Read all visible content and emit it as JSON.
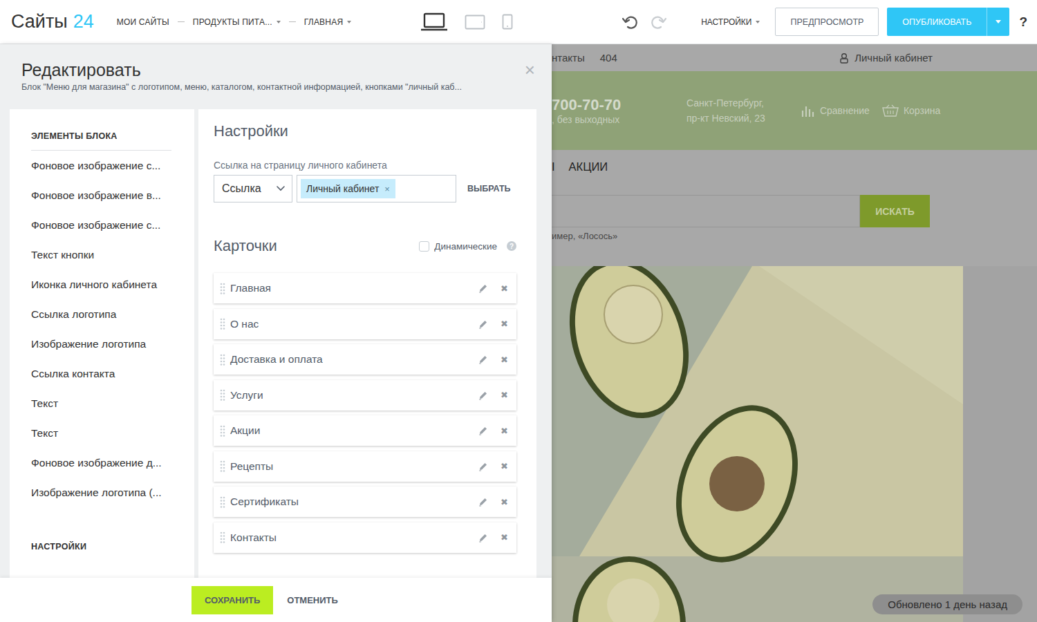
{
  "topbar": {
    "logo": {
      "word": "Сайты",
      "number": "24"
    },
    "breadcrumbs": [
      {
        "label": "МОИ САЙТЫ",
        "dropdown": false
      },
      {
        "label": "ПРОДУКТЫ ПИТА...",
        "dropdown": true
      },
      {
        "label": "ГЛАВНАЯ",
        "dropdown": true
      }
    ],
    "devices": [
      {
        "kind": "laptop",
        "selected": true
      },
      {
        "kind": "tablet",
        "selected": false
      },
      {
        "kind": "phone",
        "selected": false
      }
    ],
    "undo": {
      "disabled": false
    },
    "redo": {
      "disabled": true
    },
    "settings": {
      "label": "НАСТРОЙКИ",
      "dropdown": true
    },
    "preview_button": "ПРЕДПРОСМОТР",
    "publish_button": "ОПУБЛИКОВАТЬ",
    "help": "?"
  },
  "editor": {
    "title": "Редактировать",
    "subtitle": "Блок \"Меню для магазина\" с логотипом, меню, каталогом, контактной информацией, кнопками \"личный каб...",
    "close": "×",
    "elements_heading": "ЭЛЕМЕНТЫ БЛОКА",
    "elements": [
      {
        "label": "Фоновое изображение с...",
        "selected": false
      },
      {
        "label": "Фоновое изображение в...",
        "selected": false
      },
      {
        "label": "Фоновое изображение с...",
        "selected": false
      },
      {
        "label": "Текст кнопки",
        "selected": false
      },
      {
        "label": "Иконка личного кабинета",
        "selected": false
      },
      {
        "label": "Ссылка логотипа",
        "selected": false
      },
      {
        "label": "Изображение логотипа",
        "selected": false
      },
      {
        "label": "Ссылка контакта",
        "selected": false
      },
      {
        "label": "Текст",
        "selected": false
      },
      {
        "label": "Текст",
        "selected": false
      },
      {
        "label": "Фоновое изображение д...",
        "selected": false
      },
      {
        "label": "Изображение логотипа (...",
        "selected": false
      }
    ],
    "settings_heading": "НАСТРОЙКИ",
    "settings": {
      "title": "Настройки",
      "link_label": "Ссылка на страницу личного кабинета",
      "link_type": "Ссылка",
      "link_tag": {
        "label": "Личный кабинет",
        "remove": "×"
      },
      "choose_button": "ВЫБРАТЬ"
    },
    "cards": {
      "title": "Карточки",
      "dynamic": {
        "label": "Динамические",
        "checked": false
      },
      "help": "?",
      "items": [
        {
          "label": "Главная",
          "remove": "✖"
        },
        {
          "label": "О нас",
          "remove": "✖"
        },
        {
          "label": "Доставка и оплата",
          "remove": "✖"
        },
        {
          "label": "Услуги",
          "remove": "✖"
        },
        {
          "label": "Акции",
          "remove": "✖"
        },
        {
          "label": "Рецепты",
          "remove": "✖"
        },
        {
          "label": "Сертификаты",
          "remove": "✖"
        },
        {
          "label": "Контакты",
          "remove": "✖"
        }
      ]
    },
    "save_button": "СОХРАНИТЬ",
    "cancel_button": "ОТМЕНИТЬ"
  },
  "preview": {
    "top_links": [
      "нтакты",
      "404"
    ],
    "account": "Личный кабинет",
    "phone": "700-70-70",
    "hours": ", без выходных",
    "address": [
      "Санкт-Петербург,",
      "пр-кт Невский, 23"
    ],
    "compare": "Сравнение",
    "cart": "Корзина",
    "menu": [
      "I",
      "АКЦИИ"
    ],
    "search_button": "ИСКАТЬ",
    "search_hint": "имер, «Лосось»",
    "updated": "Обновлено 1 день назад"
  }
}
